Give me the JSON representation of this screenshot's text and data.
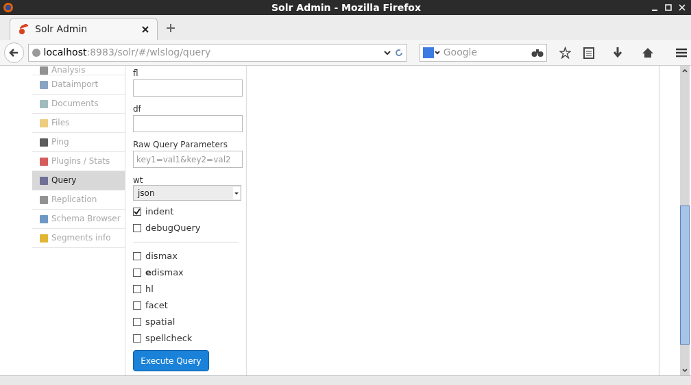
{
  "window": {
    "title": "Solr Admin - Mozilla Firefox"
  },
  "tabs": [
    {
      "label": "Solr Admin",
      "selected": true
    }
  ],
  "address_bar": {
    "host": "localhost",
    "path": ":8983/solr/#/wlslog/query"
  },
  "search": {
    "placeholder": "Google"
  },
  "sidebar": {
    "items": [
      {
        "label": "Analysis",
        "selected": false
      },
      {
        "label": "Dataimport",
        "selected": false
      },
      {
        "label": "Documents",
        "selected": false
      },
      {
        "label": "Files",
        "selected": false
      },
      {
        "label": "Ping",
        "selected": false
      },
      {
        "label": "Plugins / Stats",
        "selected": false
      },
      {
        "label": "Query",
        "selected": true
      },
      {
        "label": "Replication",
        "selected": false
      },
      {
        "label": "Schema Browser",
        "selected": false
      },
      {
        "label": "Segments info",
        "selected": false
      }
    ]
  },
  "form": {
    "fields": [
      {
        "label": "fl"
      },
      {
        "label": "df"
      },
      {
        "label": "Raw Query Parameters",
        "placeholder": "key1=val1&key2=val2"
      }
    ],
    "wt": {
      "label": "wt",
      "value": "json"
    },
    "options": [
      {
        "label": "indent",
        "checked": true
      },
      {
        "label": "debugQuery",
        "checked": false
      }
    ],
    "params": [
      {
        "label": "dismax",
        "checked": false
      },
      {
        "label": "**e**dismax",
        "checked": false
      },
      {
        "label": "hl",
        "checked": false
      },
      {
        "label": "facet",
        "checked": false
      },
      {
        "label": "spatial",
        "checked": false
      },
      {
        "label": "spellcheck",
        "checked": false
      }
    ],
    "button": "Execute Query"
  }
}
